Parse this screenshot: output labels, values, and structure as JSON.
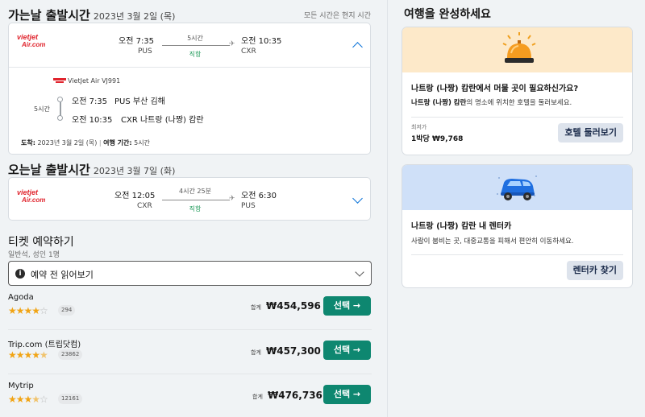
{
  "outbound": {
    "title": "가는날 출발시간",
    "date": "2023년 3월 2일 (목)",
    "tz_note": "모든 시간은 현지 시간",
    "airline_logo": [
      "vietjet",
      "Air.com"
    ],
    "dep_time": "오전 7:35",
    "dep_code": "PUS",
    "duration": "5시간",
    "stops": "직항",
    "arr_time": "오전 10:35",
    "arr_code": "CXR",
    "details": {
      "flight": "VietJet Air VJ991",
      "duration": "5시간",
      "dep_time": "오전 7:35",
      "dep_airport": "PUS 부산 김해",
      "arr_time": "오전 10:35",
      "arr_airport": "CXR 나트랑 (나짱) 캄란",
      "arrival_label": "도착:",
      "arrival_value": "2023년 3월 2일 (목)",
      "sep": "|",
      "travel_label": "여행 기간:",
      "travel_value": "5시간"
    }
  },
  "inbound": {
    "title": "오는날 출발시간",
    "date": "2023년 3월 7일 (화)",
    "airline_logo": [
      "vietjet",
      "Air.com"
    ],
    "dep_time": "오전 12:05",
    "dep_code": "CXR",
    "duration": "4시간 25분",
    "stops": "직항",
    "arr_time": "오전 6:30",
    "arr_code": "PUS"
  },
  "booking": {
    "title": "티켓 예약하기",
    "subtitle": "일반석, 성인 1명",
    "read_more": "예약 전 읽어보기",
    "info_glyph": "i",
    "total_label": "합계",
    "select_label": "선택 →",
    "providers": [
      {
        "name": "Agoda",
        "rating": 4,
        "stars": "★★★★☆",
        "reviews": "294",
        "price": "₩454,596"
      },
      {
        "name": "Trip.com (트립닷컴)",
        "rating": 4.5,
        "stars": "★★★★★",
        "reviews": "23862",
        "price": "₩457,300"
      },
      {
        "name": "Mytrip",
        "rating": 3.5,
        "stars": "★★★★☆",
        "reviews": "12161",
        "price": "₩476,736"
      }
    ]
  },
  "sidebar": {
    "title": "여행을 완성하세요",
    "hotel": {
      "band_color": "#fde9c9",
      "title": "나트랑 (나짱) 캄란에서 머물 곳이 필요하신가요?",
      "desc_bold": "나트랑 (나짱) 캄란",
      "desc_rest": "의 명소에 위치한 호텔을 둘러보세요.",
      "price_label": "최저가",
      "price": "1박당 ₩9,768",
      "button": "호텔 둘러보기"
    },
    "car": {
      "band_color": "#cfe0f8",
      "title": "나트랑 (나짱) 캄란 내 렌터카",
      "desc": "사람이 붐비는 곳, 대중교통을 피해서 편안히 이동하세요.",
      "button": "렌터카 찾기"
    }
  },
  "colors": {
    "accent_green": "#0e8770",
    "link_blue": "#0b73d9",
    "star": "#f1a414",
    "airline_red": "#e0242d"
  }
}
